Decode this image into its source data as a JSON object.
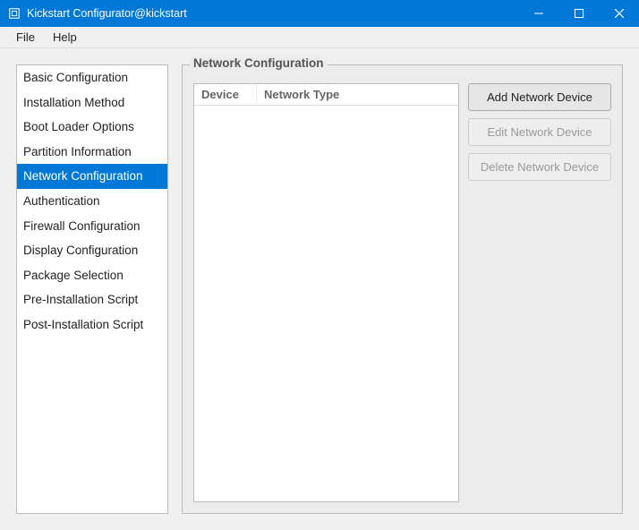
{
  "window": {
    "title": "Kickstart Configurator@kickstart"
  },
  "menubar": {
    "file": "File",
    "help": "Help"
  },
  "sidebar": {
    "items": [
      "Basic Configuration",
      "Installation Method",
      "Boot Loader Options",
      "Partition Information",
      "Network Configuration",
      "Authentication",
      "Firewall Configuration",
      "Display Configuration",
      "Package Selection",
      "Pre-Installation Script",
      "Post-Installation Script"
    ],
    "selected_index": 4
  },
  "panel": {
    "title": "Network Configuration",
    "table": {
      "col_device": "Device",
      "col_network_type": "Network Type"
    },
    "buttons": {
      "add": "Add Network Device",
      "edit": "Edit Network Device",
      "delete": "Delete Network Device",
      "edit_enabled": false,
      "delete_enabled": false
    }
  }
}
